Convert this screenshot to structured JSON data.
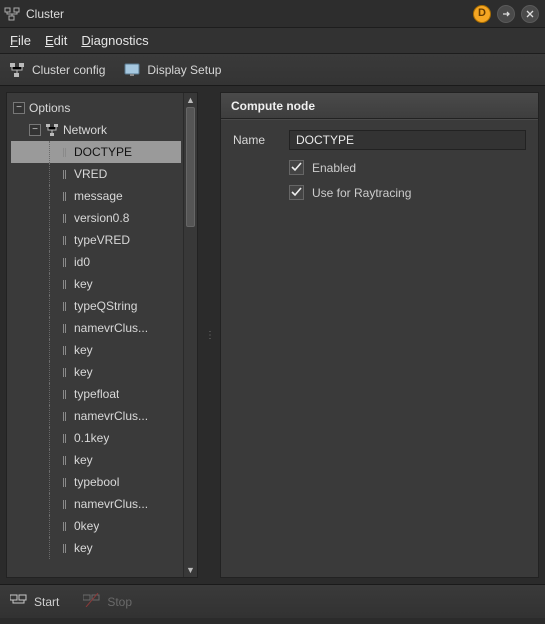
{
  "window": {
    "title": "Cluster",
    "badge_letter": "D"
  },
  "menu": {
    "file": "File",
    "edit": "Edit",
    "diagnostics": "Diagnostics"
  },
  "toolbar": {
    "cluster_config": "Cluster config",
    "display_setup": "Display Setup"
  },
  "tree": {
    "root": "Options",
    "network": "Network",
    "items": [
      "DOCTYPE",
      "VRED",
      "message",
      "version0.8",
      "typeVRED",
      "id0",
      "key",
      "typeQString",
      "namevrClus...",
      "key",
      "key",
      "typefloat",
      "namevrClus...",
      "0.1key",
      "key",
      "typebool",
      "namevrClus...",
      "0key",
      "key"
    ],
    "selected_index": 0
  },
  "detail": {
    "header": "Compute node",
    "name_label": "Name",
    "name_value": "DOCTYPE",
    "enabled_label": "Enabled",
    "enabled_checked": true,
    "raytrace_label": "Use for Raytracing",
    "raytrace_checked": true
  },
  "bottom": {
    "start": "Start",
    "stop": "Stop"
  }
}
